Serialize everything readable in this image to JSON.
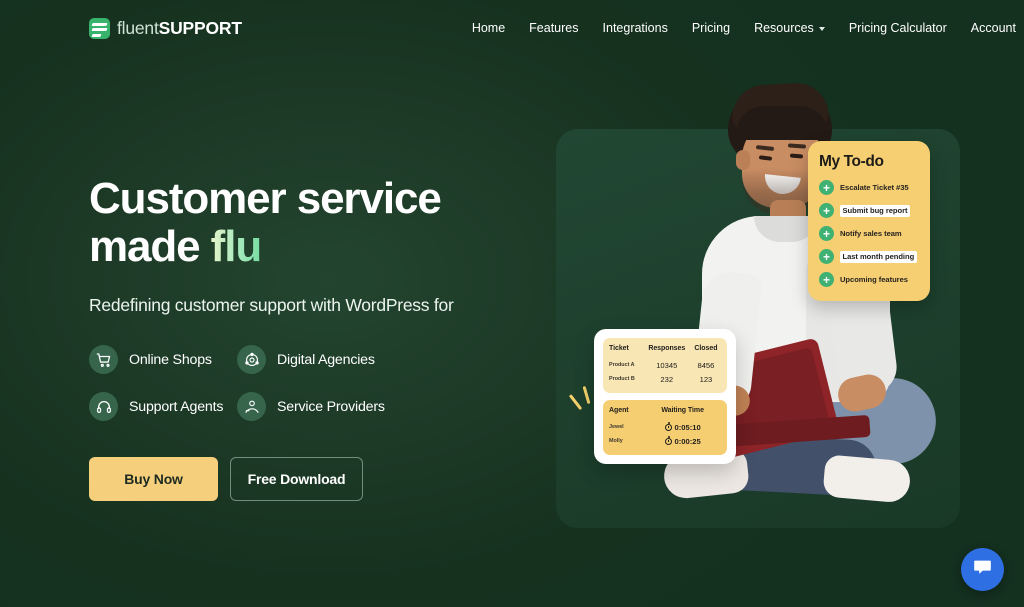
{
  "brand": {
    "name_light": "fluent",
    "name_bold": "SUPPORT",
    "logo_icon": "fluent-logo-icon"
  },
  "nav": {
    "links": [
      {
        "label": "Home",
        "has_caret": false
      },
      {
        "label": "Features",
        "has_caret": false
      },
      {
        "label": "Integrations",
        "has_caret": false
      },
      {
        "label": "Pricing",
        "has_caret": false
      },
      {
        "label": "Resources",
        "has_caret": true
      },
      {
        "label": "Pricing Calculator",
        "has_caret": false
      },
      {
        "label": "Account",
        "has_caret": false
      }
    ]
  },
  "hero": {
    "title_line1": "Customer service",
    "title_line2_static": "made ",
    "title_line2_typed": "flu",
    "subtitle": "Redefining customer support with WordPress for",
    "audiences": [
      {
        "label": "Online Shops",
        "icon": "shopping-cart-icon"
      },
      {
        "label": "Digital Agencies",
        "icon": "network-share-icon"
      },
      {
        "label": "Support Agents",
        "icon": "headset-icon"
      },
      {
        "label": "Service Providers",
        "icon": "service-hand-icon"
      }
    ],
    "buy_now_label": "Buy Now",
    "free_download_label": "Free Download"
  },
  "todo_card": {
    "title": "My To-do",
    "items": [
      {
        "text": "Escalate Ticket #35",
        "highlighted": false
      },
      {
        "text": "Submit bug report",
        "highlighted": true
      },
      {
        "text": "Notify sales team",
        "highlighted": false
      },
      {
        "text": "Last month pending",
        "highlighted": true
      },
      {
        "text": "Upcoming features",
        "highlighted": false
      }
    ]
  },
  "stats_card": {
    "ticket_table": {
      "headers": [
        "Ticket",
        "Responses",
        "Closed"
      ],
      "rows": [
        {
          "name": "Product A",
          "responses": "10345",
          "closed": "8456"
        },
        {
          "name": "Product B",
          "responses": "232",
          "closed": "123"
        }
      ]
    },
    "agent_table": {
      "headers": [
        "Agent",
        "Waiting Time"
      ],
      "rows": [
        {
          "name": "Jewel",
          "waiting_time": "0:05:10"
        },
        {
          "name": "Molly",
          "waiting_time": "0:00:25"
        }
      ]
    }
  },
  "chat_widget": {
    "icon": "chat-bubble-icon"
  },
  "colors": {
    "background": "#14301f",
    "accent_green": "#38b36b",
    "accent_yellow": "#f5cf7b",
    "card_yellow": "#f6cf72",
    "chat_blue": "#2f6fe4",
    "text_white": "#ffffff"
  }
}
